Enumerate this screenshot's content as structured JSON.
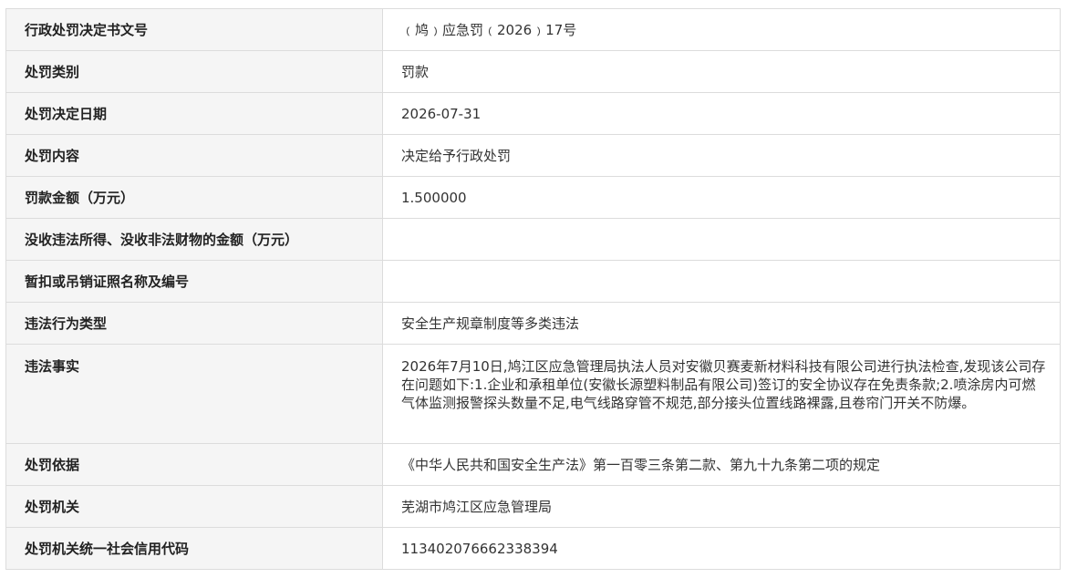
{
  "rows": [
    {
      "label": "行政处罚决定书文号",
      "value": "﹙鸠﹚应急罚﹙2026﹚17号"
    },
    {
      "label": "处罚类别",
      "value": "罚款"
    },
    {
      "label": "处罚决定日期",
      "value": "2026-07-31"
    },
    {
      "label": "处罚内容",
      "value": "决定给予行政处罚"
    },
    {
      "label": "罚款金额（万元）",
      "value": "1.500000"
    },
    {
      "label": "没收违法所得、没收非法财物的金额（万元）",
      "value": ""
    },
    {
      "label": "暂扣或吊销证照名称及编号",
      "value": ""
    },
    {
      "label": "违法行为类型",
      "value": "安全生产规章制度等多类违法"
    },
    {
      "label": "违法事实",
      "value": "2026年7月10日,鸠江区应急管理局执法人员对安徽贝赛麦新材料科技有限公司进行执法检查,发现该公司存在问题如下:1.企业和承租单位(安徽长源塑料制品有限公司)签订的安全协议存在免责条款;2.喷涂房内可燃气体监测报警探头数量不足,电气线路穿管不规范,部分接头位置线路裸露,且卷帘门开关不防爆。"
    },
    {
      "label": "处罚依据",
      "value": "《中华人民共和国安全生产法》第一百零三条第二款、第九十九条第二项的规定"
    },
    {
      "label": "处罚机关",
      "value": "芜湖市鸠江区应急管理局"
    },
    {
      "label": "处罚机关统一社会信用代码",
      "value": "11340207666233839​4"
    }
  ]
}
